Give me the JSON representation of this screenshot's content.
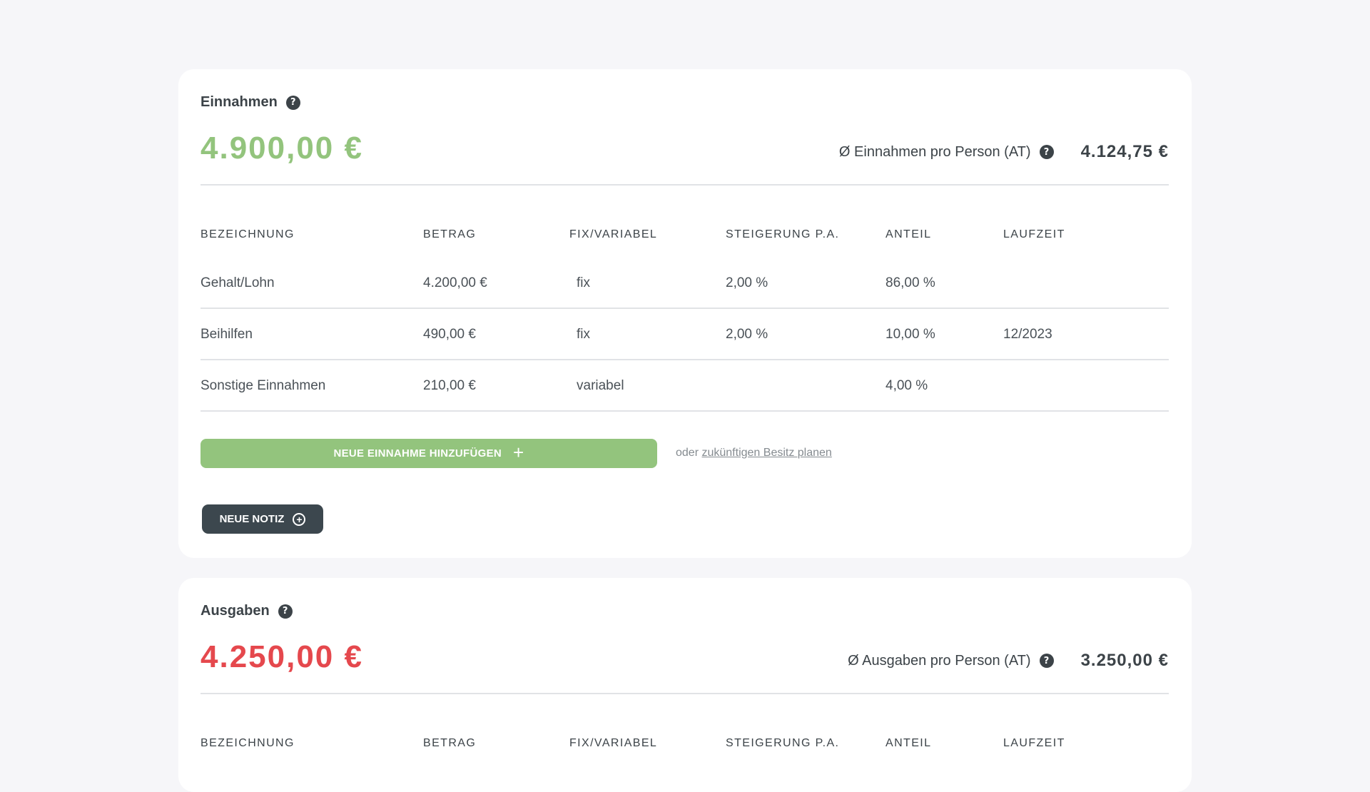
{
  "income": {
    "title": "Einnahmen",
    "help_icon": "?",
    "total": "4.900,00 €",
    "total_color": "#93c47d",
    "avg_label": "Ø Einnahmen pro Person (AT)",
    "avg_value": "4.124,75 €",
    "columns": [
      "BEZEICHNUNG",
      "BETRAG",
      "FIX/VARIABEL",
      "STEIGERUNG P.A.",
      "ANTEIL",
      "LAUFZEIT"
    ],
    "rows": [
      {
        "name": "Gehalt/Lohn",
        "amount": "4.200,00 €",
        "type": "fix",
        "increase": "2,00 %",
        "share": "86,00 %",
        "term": ""
      },
      {
        "name": "Beihilfen",
        "amount": "490,00 €",
        "type": "fix",
        "increase": "2,00 %",
        "share": "10,00 %",
        "term": "12/2023"
      },
      {
        "name": "Sonstige Einnahmen",
        "amount": "210,00 €",
        "type": "variabel",
        "increase": "",
        "share": "4,00 %",
        "term": ""
      }
    ],
    "add_button": "NEUE EINNAHME HINZUFÜGEN",
    "add_icon": "+",
    "or_text": "oder",
    "plan_link": "zukünftigen Besitz planen",
    "note_button": "NEUE NOTIZ",
    "note_icon": "+"
  },
  "expenses": {
    "title": "Ausgaben",
    "help_icon": "?",
    "total": "4.250,00 €",
    "total_color": "#e5484d",
    "avg_label": "Ø Ausgaben pro Person (AT)",
    "avg_value": "3.250,00 €",
    "columns": [
      "BEZEICHNUNG",
      "BETRAG",
      "FIX/VARIABEL",
      "STEIGERUNG P.A.",
      "ANTEIL",
      "LAUFZEIT"
    ]
  }
}
